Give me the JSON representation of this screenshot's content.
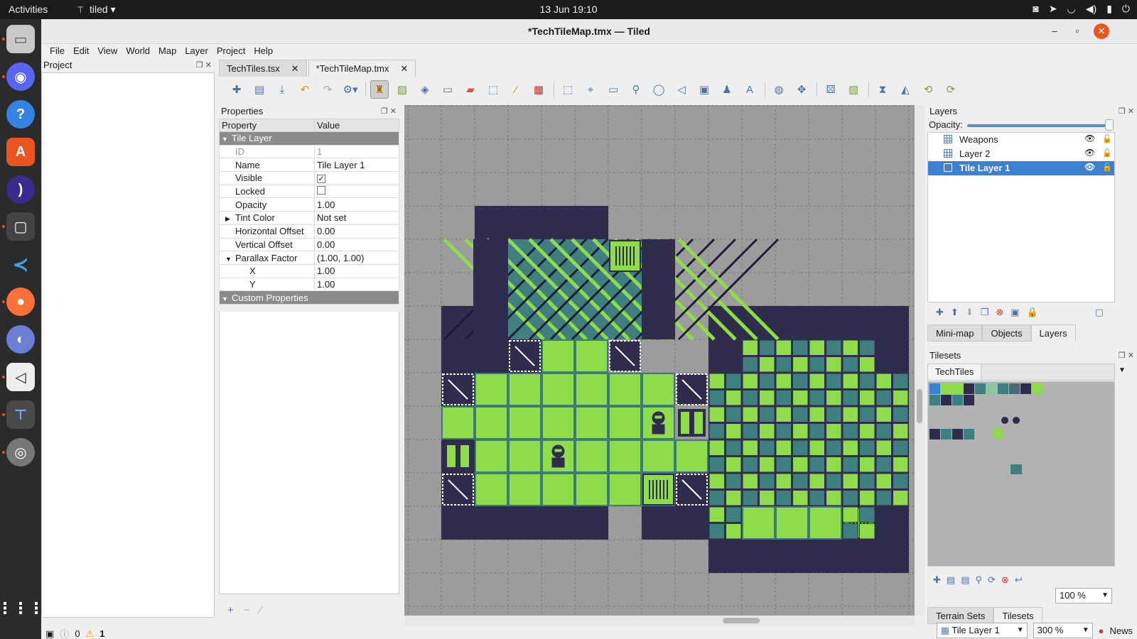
{
  "topbar": {
    "activities": "Activities",
    "app_name": "tiled",
    "clock": "13 Jun  19:10",
    "tray_icons": [
      "discord-tray-icon",
      "telegram-tray-icon",
      "wifi-icon",
      "volume-icon",
      "battery-icon",
      "power-icon"
    ]
  },
  "dock": {
    "items": [
      "files",
      "discord",
      "help",
      "app-center",
      "podcasts",
      "twitch",
      "vscode",
      "firefox",
      "browser",
      "unity",
      "tiled",
      "disks"
    ]
  },
  "window": {
    "title": "*TechTileMap.tmx — Tiled",
    "minimize": "–",
    "maximize": "▫",
    "close": "✕"
  },
  "menu": [
    "File",
    "Edit",
    "View",
    "World",
    "Map",
    "Layer",
    "Project",
    "Help"
  ],
  "project_panel": {
    "title": "Project"
  },
  "tabs": [
    {
      "label": "TechTiles.tsx",
      "close": "✕"
    },
    {
      "label": "*TechTileMap.tmx",
      "close": "✕"
    }
  ],
  "properties": {
    "title": "Properties",
    "col_property": "Property",
    "col_value": "Value",
    "group_tile_layer": "Tile Layer",
    "rows": [
      {
        "name": "ID",
        "value": "1"
      },
      {
        "name": "Name",
        "value": "Tile Layer 1"
      },
      {
        "name": "Visible",
        "value": "✓"
      },
      {
        "name": "Locked",
        "value": ""
      },
      {
        "name": "Opacity",
        "value": "1.00"
      },
      {
        "name": "Tint Color",
        "value": "Not set"
      },
      {
        "name": "Horizontal Offset",
        "value": "0.00"
      },
      {
        "name": "Vertical Offset",
        "value": "0.00"
      },
      {
        "name": "Parallax Factor",
        "value": "(1.00, 1.00)"
      },
      {
        "name": "X",
        "value": "1.00"
      },
      {
        "name": "Y",
        "value": "1.00"
      }
    ],
    "group_custom": "Custom Properties"
  },
  "layers": {
    "title": "Layers",
    "opacity_label": "Opacity:",
    "opacity_value": 1.0,
    "items": [
      {
        "name": "Weapons"
      },
      {
        "name": "Layer 2"
      },
      {
        "name": "Tile Layer 1"
      }
    ],
    "tabs": [
      "Mini-map",
      "Objects",
      "Layers"
    ]
  },
  "tilesets": {
    "title": "Tilesets",
    "active": "TechTiles",
    "zoom": "100 %",
    "tabs": [
      "Terrain Sets",
      "Tilesets"
    ]
  },
  "status": {
    "errors": "0",
    "warnings": "1",
    "layer": "Tile Layer 1",
    "zoom": "300 %",
    "news": "News"
  },
  "colors": {
    "bg_dark": "#2f2c4e",
    "tile_light": "#8fdc4a",
    "tile_teal": "#3f7f80",
    "selection": "#3d7fd1",
    "accent": "#e95420"
  }
}
